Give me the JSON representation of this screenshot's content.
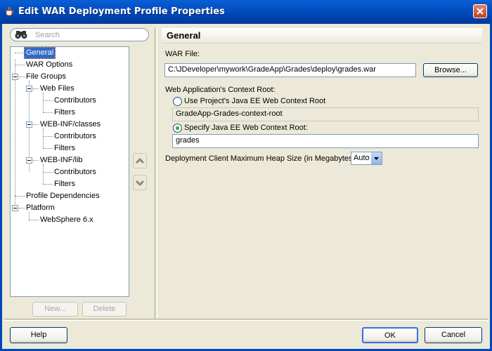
{
  "window": {
    "title": "Edit WAR Deployment Profile Properties"
  },
  "search": {
    "placeholder": "Search"
  },
  "tree": {
    "general": "General",
    "war_options": "WAR Options",
    "file_groups": "File Groups",
    "web_files": "Web Files",
    "web_files_contributors": "Contributors",
    "web_files_filters": "Filters",
    "webinf_classes": "WEB-INF/classes",
    "webinf_classes_contributors": "Contributors",
    "webinf_classes_filters": "Filters",
    "webinf_lib": "WEB-INF/lib",
    "webinf_lib_contributors": "Contributors",
    "webinf_lib_filters": "Filters",
    "profile_dependencies": "Profile Dependencies",
    "platform": "Platform",
    "websphere": "WebSphere 6.x"
  },
  "tree_buttons": {
    "new": "New...",
    "delete": "Delete"
  },
  "panel": {
    "title": "General",
    "war_file_label": "WAR File:",
    "war_file_value": "C:\\JDeveloper\\mywork\\GradeApp\\Grades\\deploy\\grades.war",
    "browse": "Browse...",
    "context_root_label": "Web Application's Context Root:",
    "radio_project": "Use Project's Java EE Web Context Root",
    "project_context_root": "GradeApp-Grades-context-root",
    "radio_specify": "Specify Java EE Web Context Root:",
    "specify_value": "grades",
    "heap_label": "Deployment Client Maximum Heap Size (in Megabytes):",
    "heap_value": "Auto"
  },
  "footer": {
    "help": "Help",
    "ok": "OK",
    "cancel": "Cancel"
  }
}
